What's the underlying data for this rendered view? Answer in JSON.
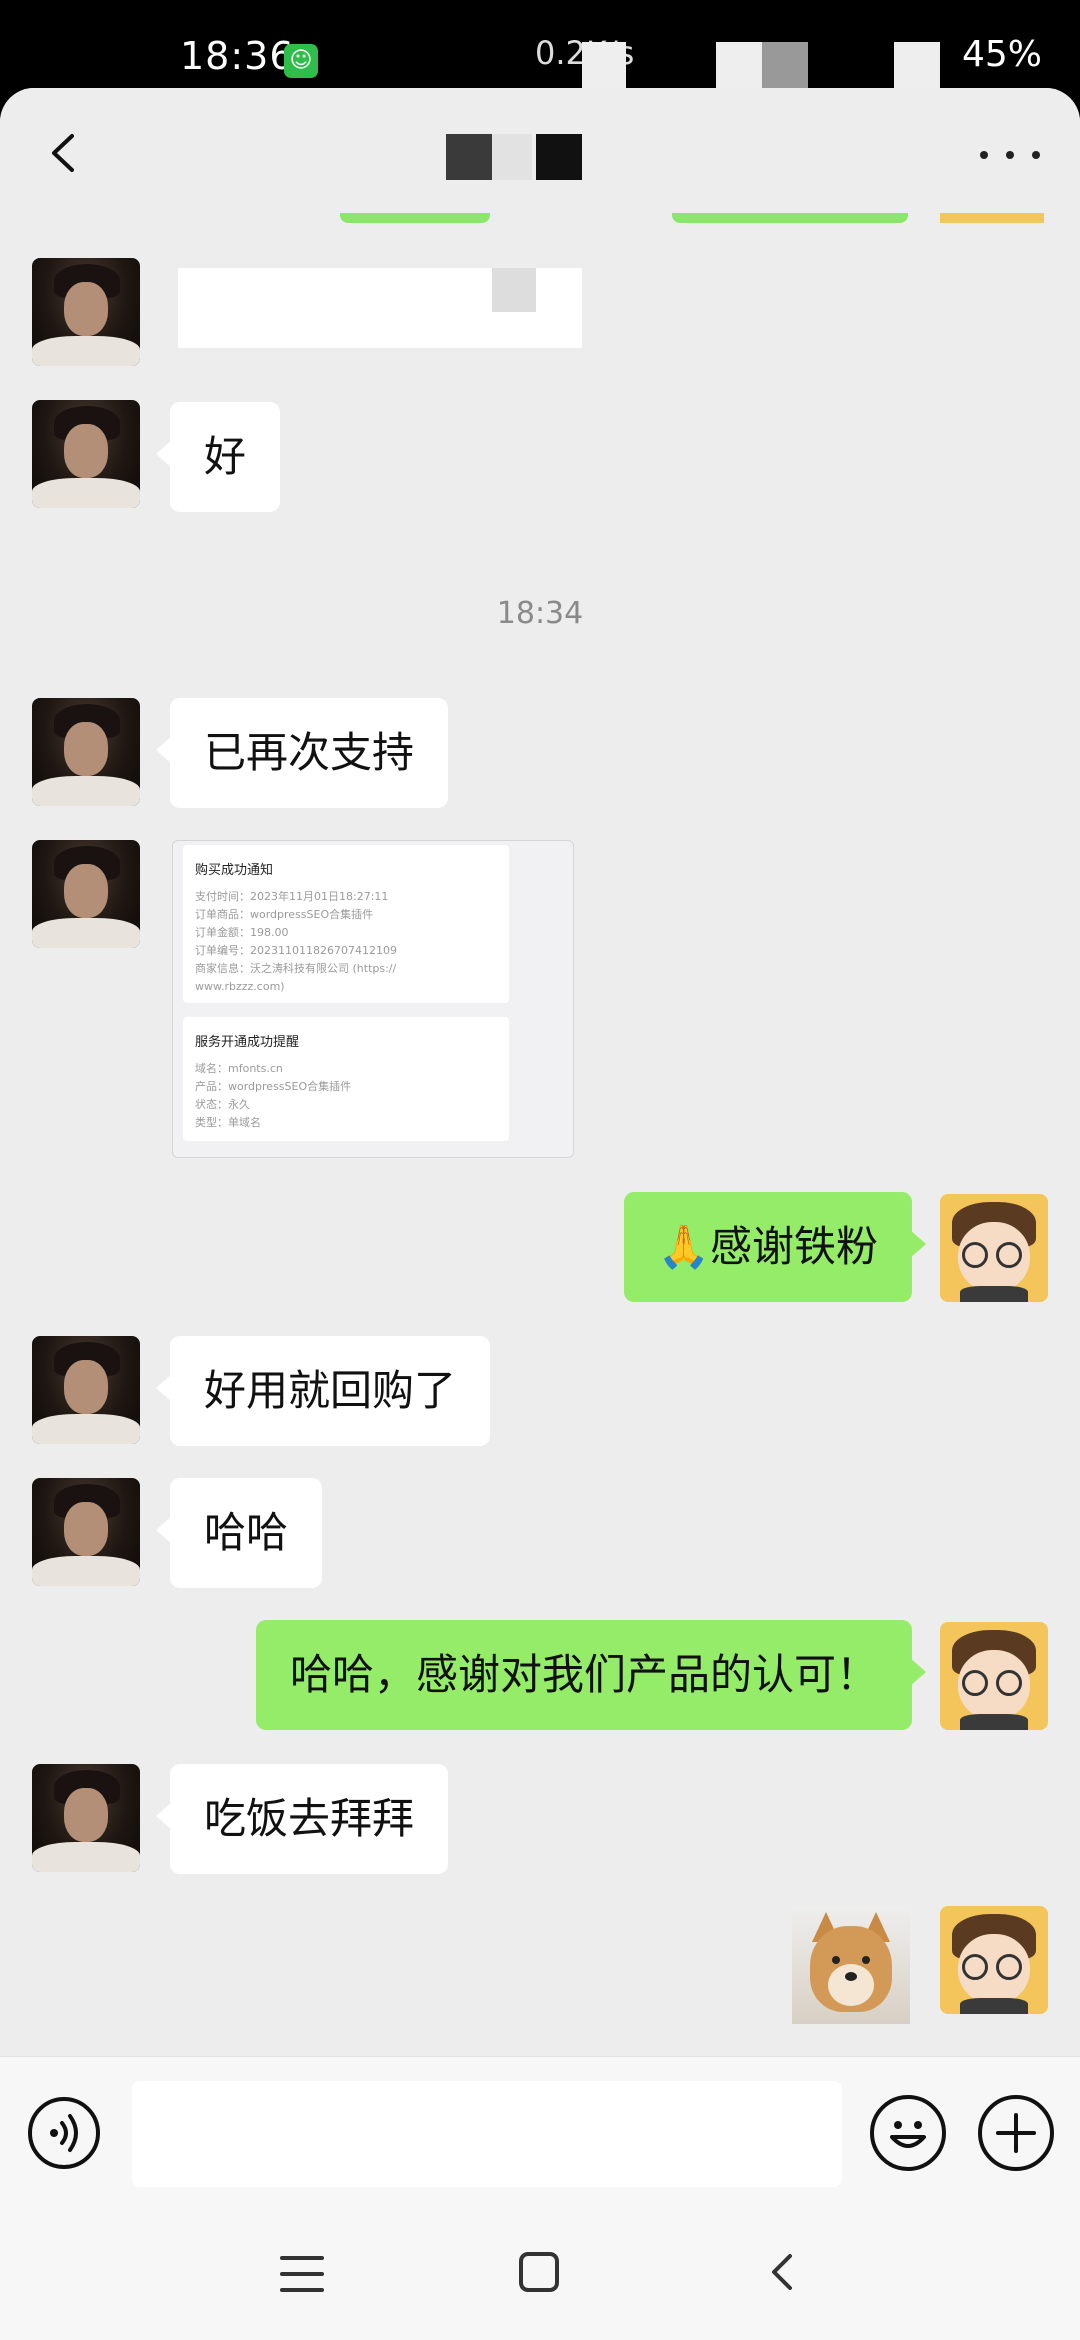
{
  "status_bar": {
    "time": "18:36",
    "app_icon_glyph": "☺",
    "network_speed": "0.2K/s",
    "battery": "45%"
  },
  "header": {
    "title": "",
    "back_icon": "chevron-left-icon",
    "more_icon": "more-dots-icon"
  },
  "messages": [
    {
      "id": 1,
      "side": "left",
      "type": "redacted",
      "text": ""
    },
    {
      "id": 2,
      "side": "left",
      "type": "text",
      "text": "好"
    },
    {
      "id": 3,
      "type": "timestamp",
      "text": "18:34"
    },
    {
      "id": 4,
      "side": "left",
      "type": "text",
      "text": "已再次支持"
    },
    {
      "id": 5,
      "side": "left",
      "type": "image"
    },
    {
      "id": 6,
      "side": "right",
      "type": "text",
      "text": "🙏感谢铁粉"
    },
    {
      "id": 7,
      "side": "left",
      "type": "text",
      "text": "好用就回购了"
    },
    {
      "id": 8,
      "side": "left",
      "type": "text",
      "text": "哈哈"
    },
    {
      "id": 9,
      "side": "right",
      "type": "text",
      "text": "哈哈，感谢对我们产品的认可！"
    },
    {
      "id": 10,
      "side": "left",
      "type": "text",
      "text": "吃饭去拜拜"
    },
    {
      "id": 11,
      "side": "right",
      "type": "sticker",
      "sticker": "shiba-dog-sticker"
    }
  ],
  "receipt": {
    "purchase_title": "购买成功通知",
    "purchase_lines": [
      "支付时间：2023年11月01日18:27:11",
      "订单商品：wordpressSEO合集插件",
      "订单金额：198.00",
      "订单编号：2023110118267074121​09",
      "商家信息：沃之涛科技有限公司 (https://",
      "www.rbzzz.com)"
    ],
    "service_title": "服务开通成功提醒",
    "service_lines": [
      "域名：mfonts.cn",
      "产品：wordpressSEO合集插件",
      "状态：永久",
      "类型：单域名"
    ]
  },
  "input_bar": {
    "placeholder": "",
    "voice_icon": "voice-icon",
    "emoji_icon": "emoji-icon",
    "plus_icon": "plus-icon"
  },
  "nav_bar": {
    "menu_icon": "menu-icon",
    "home_icon": "home-icon",
    "back_icon": "back-icon"
  },
  "colors": {
    "chat_bg": "#ededed",
    "sent_bubble": "#95ec69",
    "received_bubble": "#ffffff",
    "timestamp_text": "#8a8a8a"
  }
}
